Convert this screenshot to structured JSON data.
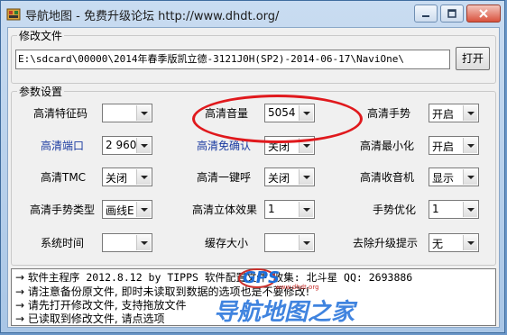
{
  "window": {
    "title": "导航地图 - 免费升级论坛 http://www.dhdt.org/"
  },
  "file_group": {
    "label": "修改文件",
    "path": "E:\\sdcard\\00000\\2014年春季版凯立德-3121J0H(SP2)-2014-06-17\\NaviOne\\",
    "open_button": "打开"
  },
  "params_group": {
    "label": "参数设置",
    "items": [
      {
        "label": "高清特征码",
        "value": "",
        "color": "black"
      },
      {
        "label": "高清音量",
        "value": "5054",
        "color": "black"
      },
      {
        "label": "高清手势",
        "value": "开启",
        "color": "black"
      },
      {
        "label": "高清端口",
        "value": "2 960",
        "color": "blue"
      },
      {
        "label": "高清免确认",
        "value": "关闭",
        "color": "blue"
      },
      {
        "label": "高清最小化",
        "value": "开启",
        "color": "black"
      },
      {
        "label": "高清TMC",
        "value": "关闭",
        "color": "black"
      },
      {
        "label": "高清一键呼",
        "value": "关闭",
        "color": "black"
      },
      {
        "label": "高清收音机",
        "value": "显示",
        "color": "black"
      },
      {
        "label": "高清手势类型",
        "value": "画线E",
        "color": "black"
      },
      {
        "label": "高清立体效果",
        "value": "1",
        "color": "black"
      },
      {
        "label": "手势优化",
        "value": "1",
        "color": "black"
      },
      {
        "label": "系统时间",
        "value": "",
        "color": "black"
      },
      {
        "label": "缓存大小",
        "value": "",
        "color": "black"
      },
      {
        "label": "去除升级提示",
        "value": "无",
        "color": "black"
      }
    ]
  },
  "log": {
    "lines": [
      {
        "arrow": "→",
        "text": "软件主程序 2012.8.12 by TIPPS     软件配置文件 收集: 北斗星 QQ: 2693886"
      },
      {
        "arrow": "→",
        "text": "请注意备份原文件, 即时未读取到数据的选项也是不要修改!"
      },
      {
        "arrow": "→",
        "text": "请先打开修改文件, 支持拖放文件"
      },
      {
        "arrow": "→",
        "text": "已读取到修改文件, 请点选项"
      }
    ]
  },
  "watermark": {
    "logo_text": "GPS",
    "site_text": "导航地图之家",
    "url_text": "www.dhdt.org"
  },
  "colors": {
    "highlight_oval": "#e0191d",
    "blue_label": "#1a3aa0",
    "watermark_blue": "#1e6fd9"
  }
}
